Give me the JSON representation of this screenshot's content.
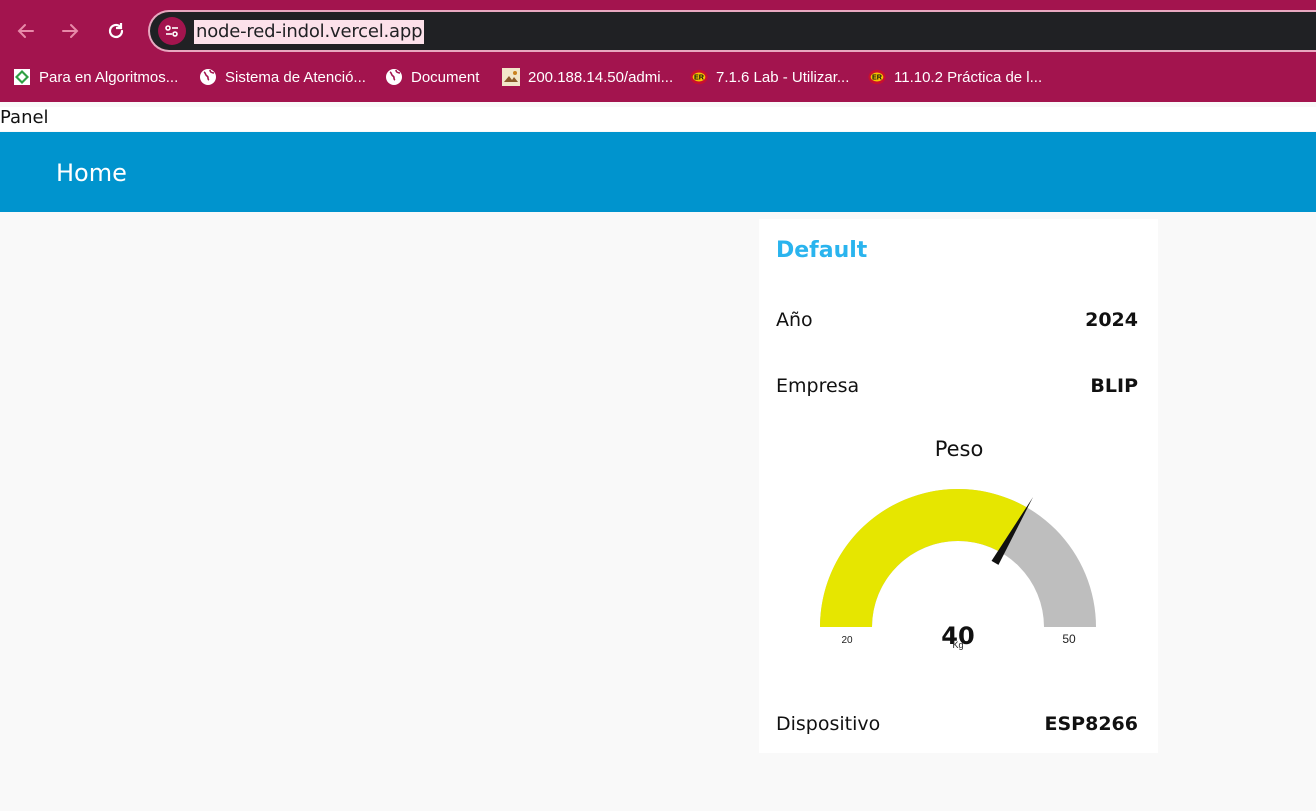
{
  "browser": {
    "url": "node-red-indol.vercel.app",
    "bookmarks": [
      {
        "label": "Para en Algoritmos...",
        "icon": "green-diamond-icon"
      },
      {
        "label": "Sistema de Atenció...",
        "icon": "globe-icon"
      },
      {
        "label": "Document",
        "icon": "globe-icon"
      },
      {
        "label": "200.188.14.50/admi...",
        "icon": "site-thumbnail-icon"
      },
      {
        "label": "7.1.6 Lab - Utilizar...",
        "icon": "er-badge-icon"
      },
      {
        "label": "11.10.2 Práctica de l...",
        "icon": "er-badge-icon"
      }
    ]
  },
  "page": {
    "panel_label": "Panel",
    "appbar_title": "Home"
  },
  "group": {
    "title": "Default",
    "rows": [
      {
        "label": "Año",
        "value": "2024"
      },
      {
        "label": "Empresa",
        "value": "BLIP"
      }
    ],
    "gauge": {
      "title": "Peso",
      "value": 40,
      "value_text": "40",
      "unit": "Kg",
      "min": 20,
      "max": 50,
      "min_text": "20",
      "max_text": "50",
      "fill_color": "#e6e600",
      "track_color": "#bebebe"
    },
    "footer_row": {
      "label": "Dispositivo",
      "value": "ESP8266"
    }
  },
  "colors": {
    "browser_frame": "#a3144e",
    "appbar": "#0094ce",
    "group_title": "#2ab4ee"
  }
}
